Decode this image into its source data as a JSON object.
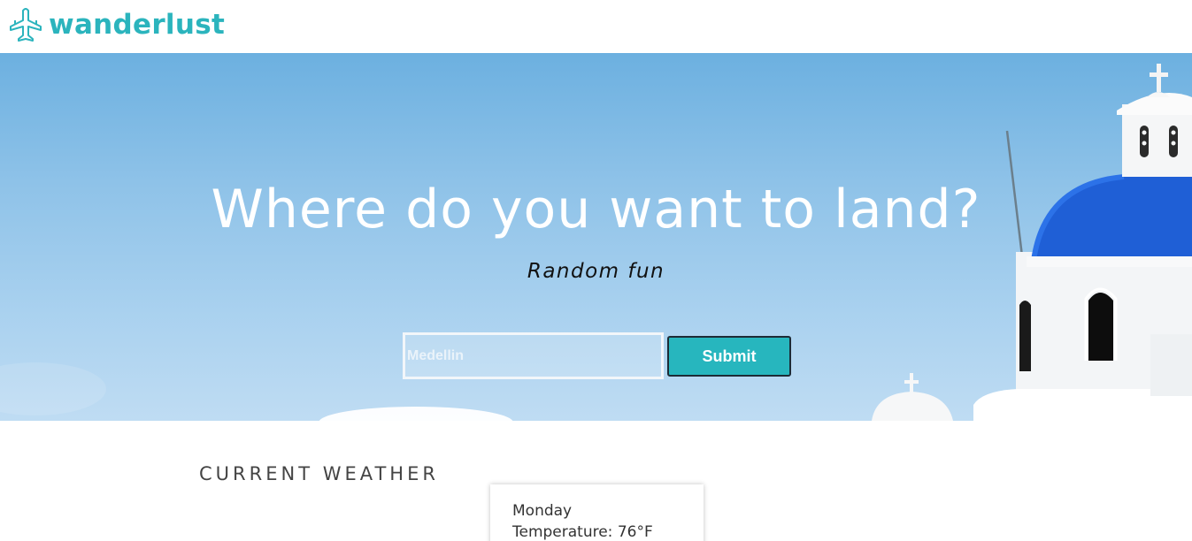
{
  "brand": {
    "name": "wanderlust",
    "icon": "airplane-icon",
    "color": "#2bb4bd"
  },
  "hero": {
    "title": "Where do you want to land?",
    "subtitle": "Random fun",
    "search": {
      "placeholder": "Medellin",
      "value": ""
    },
    "submit_label": "Submit"
  },
  "weather": {
    "heading": "CURRENT WEATHER",
    "day": "Monday",
    "temperature": "Temperature: 76°F"
  },
  "colors": {
    "accent": "#27b6be",
    "sky": "#8ec2e8",
    "dome": "#1f5fd6"
  }
}
